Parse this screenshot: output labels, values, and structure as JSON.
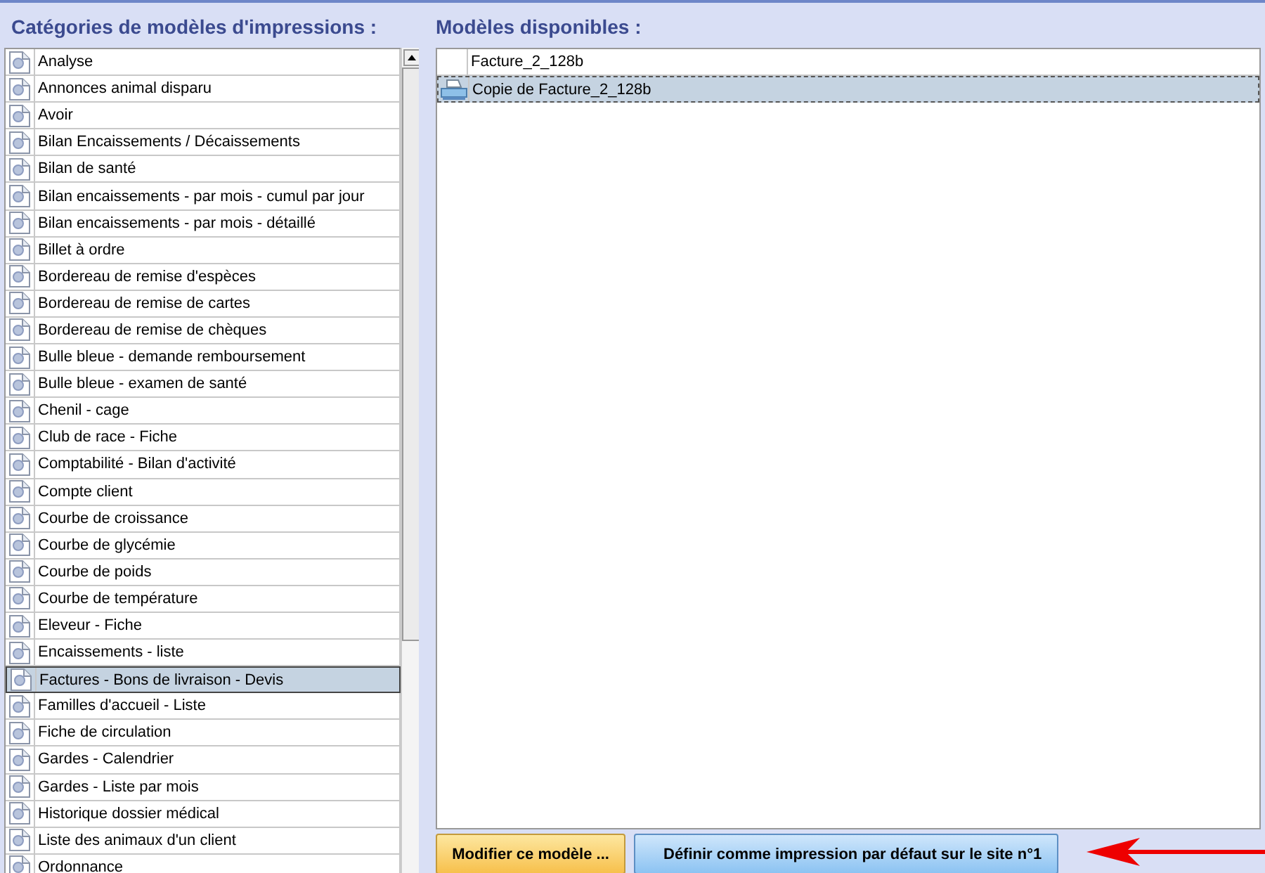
{
  "categories_panel": {
    "title": "Catégories de modèles d'impressions :",
    "items": [
      {
        "label": "Analyse",
        "selected": false
      },
      {
        "label": "Annonces animal disparu",
        "selected": false
      },
      {
        "label": "Avoir",
        "selected": false
      },
      {
        "label": "Bilan Encaissements / Décaissements",
        "selected": false
      },
      {
        "label": "Bilan de santé",
        "selected": false
      },
      {
        "label": "Bilan encaissements - par mois - cumul par jour",
        "selected": false
      },
      {
        "label": "Bilan encaissements - par mois - détaillé",
        "selected": false
      },
      {
        "label": "Billet à ordre",
        "selected": false
      },
      {
        "label": "Bordereau de remise d'espèces",
        "selected": false
      },
      {
        "label": "Bordereau de remise de cartes",
        "selected": false
      },
      {
        "label": "Bordereau de remise de chèques",
        "selected": false
      },
      {
        "label": "Bulle bleue - demande remboursement",
        "selected": false
      },
      {
        "label": "Bulle bleue - examen de santé",
        "selected": false
      },
      {
        "label": "Chenil - cage",
        "selected": false
      },
      {
        "label": "Club de race - Fiche",
        "selected": false
      },
      {
        "label": "Comptabilité - Bilan d'activité",
        "selected": false
      },
      {
        "label": "Compte client",
        "selected": false
      },
      {
        "label": "Courbe de croissance",
        "selected": false
      },
      {
        "label": "Courbe de glycémie",
        "selected": false
      },
      {
        "label": "Courbe de poids",
        "selected": false
      },
      {
        "label": "Courbe de température",
        "selected": false
      },
      {
        "label": "Eleveur - Fiche",
        "selected": false
      },
      {
        "label": "Encaissements - liste",
        "selected": false
      },
      {
        "label": "Factures - Bons de livraison - Devis",
        "selected": true
      },
      {
        "label": "Familles d'accueil - Liste",
        "selected": false
      },
      {
        "label": "Fiche de circulation",
        "selected": false
      },
      {
        "label": "Gardes - Calendrier",
        "selected": false
      },
      {
        "label": "Gardes - Liste par mois",
        "selected": false
      },
      {
        "label": "Historique dossier médical",
        "selected": false
      },
      {
        "label": "Liste des animaux d'un client",
        "selected": false
      },
      {
        "label": "Ordonnance",
        "selected": false
      }
    ]
  },
  "models_panel": {
    "title": "Modèles disponibles :",
    "items": [
      {
        "label": "Facture_2_128b",
        "selected": false,
        "is_default": false
      },
      {
        "label": "Copie de Facture_2_128b",
        "selected": true,
        "is_default": true
      }
    ]
  },
  "buttons": [
    {
      "label": "Modifier ce modèle ...",
      "kind": "edit"
    },
    {
      "label": "Définir comme impression par défaut sur le site n°1",
      "kind": "set-default"
    }
  ]
}
